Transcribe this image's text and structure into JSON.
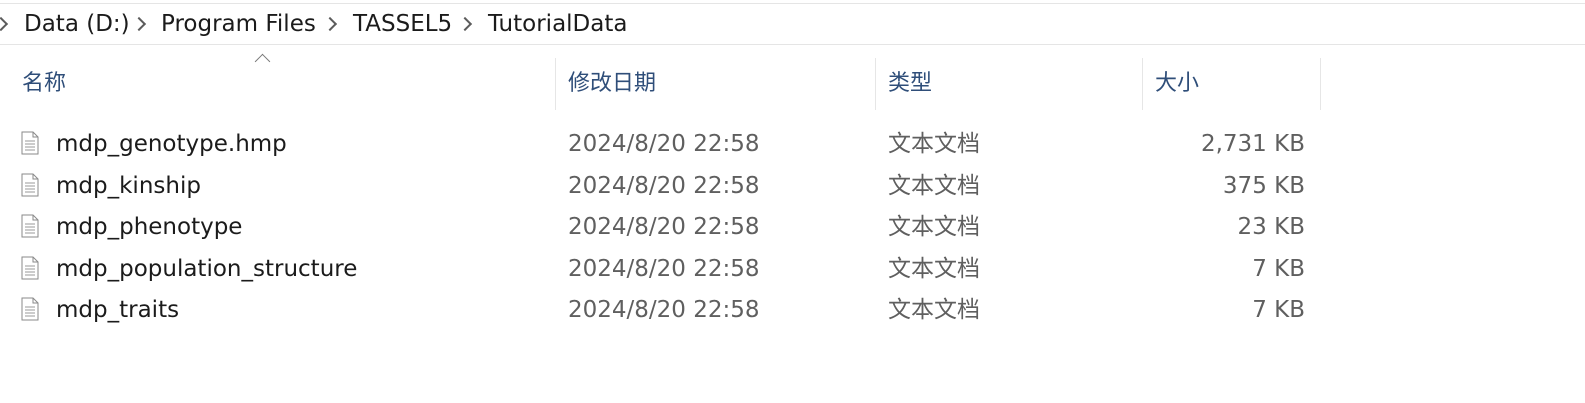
{
  "breadcrumb": {
    "items": [
      {
        "label": "Data (D:)"
      },
      {
        "label": "Program Files"
      },
      {
        "label": "TASSEL5"
      },
      {
        "label": "TutorialData"
      }
    ]
  },
  "columns": {
    "name": "名称",
    "date": "修改日期",
    "type": "类型",
    "size": "大小"
  },
  "sort": {
    "column": "name",
    "direction": "ascending",
    "icon": "chevron-up-icon"
  },
  "files": [
    {
      "name": "mdp_genotype.hmp",
      "date": "2024/8/20 22:58",
      "type": "文本文档",
      "size": "2,731 KB",
      "icon": "text-document-icon"
    },
    {
      "name": "mdp_kinship",
      "date": "2024/8/20 22:58",
      "type": "文本文档",
      "size": "375 KB",
      "icon": "text-document-icon"
    },
    {
      "name": "mdp_phenotype",
      "date": "2024/8/20 22:58",
      "type": "文本文档",
      "size": "23 KB",
      "icon": "text-document-icon"
    },
    {
      "name": "mdp_population_structure",
      "date": "2024/8/20 22:58",
      "type": "文本文档",
      "size": "7 KB",
      "icon": "text-document-icon"
    },
    {
      "name": "mdp_traits",
      "date": "2024/8/20 22:58",
      "type": "文本文档",
      "size": "7 KB",
      "icon": "text-document-icon"
    }
  ]
}
